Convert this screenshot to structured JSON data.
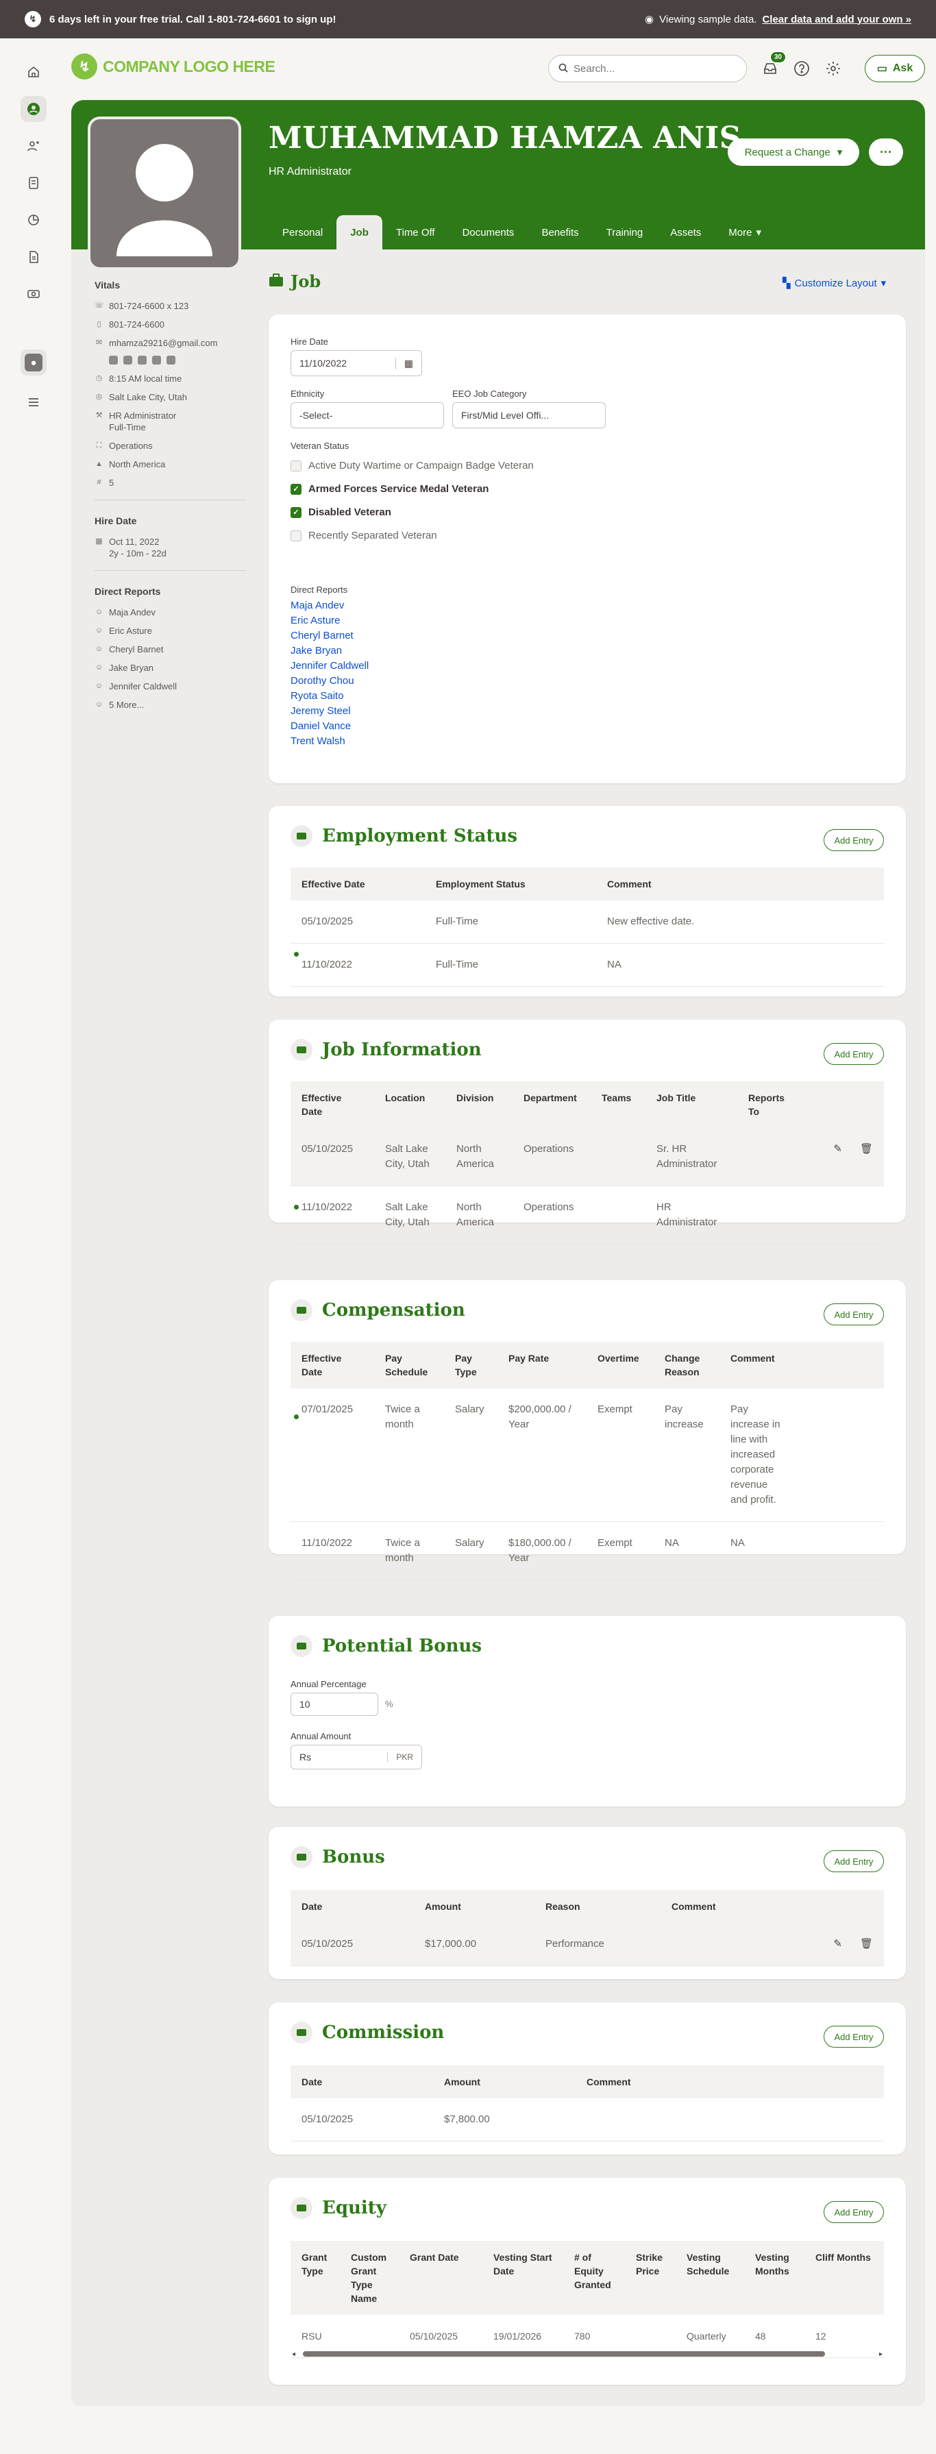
{
  "banner": {
    "days_text": "6 days left in your free trial.",
    "call_text": "Call 1-801-724-6601 to sign up!",
    "viewing": "Viewing sample data.",
    "clear_link": "Clear data and add your own »"
  },
  "header": {
    "logo": "COMPANY LOGO HERE",
    "search_placeholder": "Search...",
    "inbox_count": "30",
    "ask_label": "Ask"
  },
  "profile": {
    "name": "MUHAMMAD HAMZA ANIS",
    "title": "HR Administrator",
    "request_label": "Request a Change"
  },
  "tabs": [
    "Personal",
    "Job",
    "Time Off",
    "Documents",
    "Benefits",
    "Training",
    "Assets",
    "More"
  ],
  "vitals": {
    "heading": "Vitals",
    "phone_work": "801-724-6600 x 123",
    "phone_mobile": "801-724-6600",
    "email": "mhamza29216@gmail.com",
    "local_time": "8:15 AM local time",
    "location": "Salt Lake City, Utah",
    "job_title": "HR Administrator",
    "job_type": "Full-Time",
    "department": "Operations",
    "region": "North America",
    "employee_no": "5"
  },
  "hire": {
    "heading": "Hire Date",
    "date": "Oct 11, 2022",
    "tenure": "2y - 10m - 22d"
  },
  "direct_side": {
    "heading": "Direct Reports",
    "names": [
      "Maja Andev",
      "Eric Asture",
      "Cheryl Barnet",
      "Jake Bryan",
      "Jennifer Caldwell"
    ],
    "more": "5 More..."
  },
  "job": {
    "heading": "Job",
    "customize": "Customize Layout",
    "hire_label": "Hire Date",
    "hire_value": "11/10/2022",
    "ethnicity_label": "Ethnicity",
    "ethnicity_value": "-Select-",
    "eeo_label": "EEO Job Category",
    "eeo_value": "First/Mid Level Offi...",
    "veteran_label": "Veteran Status",
    "veteran": [
      {
        "label": "Active Duty Wartime or Campaign Badge Veteran",
        "checked": false
      },
      {
        "label": "Armed Forces Service Medal Veteran",
        "checked": true
      },
      {
        "label": "Disabled Veteran",
        "checked": true
      },
      {
        "label": "Recently Separated Veteran",
        "checked": false
      }
    ],
    "reports_label": "Direct Reports",
    "reports": [
      "Maja Andev",
      "Eric Asture",
      "Cheryl Barnet",
      "Jake Bryan",
      "Jennifer Caldwell",
      "Dorothy Chou",
      "Ryota Saito",
      "Jeremy Steel",
      "Daniel Vance",
      "Trent Walsh"
    ]
  },
  "add_entry": "Add Entry",
  "employment": {
    "heading": "Employment Status",
    "cols": [
      "Effective Date",
      "Employment Status",
      "Comment"
    ],
    "rows": [
      [
        "05/10/2025",
        "Full-Time",
        "New effective date."
      ],
      [
        "11/10/2022",
        "Full-Time",
        "NA"
      ]
    ]
  },
  "jobinfo": {
    "heading": "Job Information",
    "cols": [
      "Effective Date",
      "Location",
      "Division",
      "Department",
      "Teams",
      "Job Title",
      "Reports To"
    ],
    "rows": [
      [
        "05/10/2025",
        "Salt Lake City, Utah",
        "North America",
        "Operations",
        "",
        "Sr. HR Administrator",
        ""
      ],
      [
        "11/10/2022",
        "Salt Lake City, Utah",
        "North America",
        "Operations",
        "",
        "HR Administrator",
        ""
      ]
    ]
  },
  "comp": {
    "heading": "Compensation",
    "cols": [
      "Effective Date",
      "Pay Schedule",
      "Pay Type",
      "Pay Rate",
      "Overtime",
      "Change Reason",
      "Comment"
    ],
    "rows": [
      [
        "07/01/2025",
        "Twice a month",
        "Salary",
        "$200,000.00 / Year",
        "Exempt",
        "Pay increase",
        "Pay increase in line with increased corporate revenue and profit."
      ],
      [
        "11/10/2022",
        "Twice a month",
        "Salary",
        "$180,000.00 / Year",
        "Exempt",
        "NA",
        "NA"
      ]
    ]
  },
  "potential": {
    "heading": "Potential Bonus",
    "pct_label": "Annual Percentage",
    "pct_value": "10",
    "pct_unit": "%",
    "amt_label": "Annual Amount",
    "amt_prefix": "Rs",
    "amt_unit": "PKR"
  },
  "bonus": {
    "heading": "Bonus",
    "cols": [
      "Date",
      "Amount",
      "Reason",
      "Comment"
    ],
    "rows": [
      [
        "05/10/2025",
        "$17,000.00",
        "Performance",
        ""
      ]
    ]
  },
  "commission": {
    "heading": "Commission",
    "cols": [
      "Date",
      "Amount",
      "Comment"
    ],
    "rows": [
      [
        "05/10/2025",
        "$7,800.00",
        ""
      ]
    ]
  },
  "equity": {
    "heading": "Equity",
    "cols": [
      "Grant Type",
      "Custom Grant Type Name",
      "Grant Date",
      "Vesting Start Date",
      "# of Equity Granted",
      "Strike Price",
      "Vesting Schedule",
      "Vesting Months",
      "Cliff Months"
    ],
    "rows": [
      [
        "RSU",
        "",
        "05/10/2025",
        "19/01/2026",
        "780",
        "",
        "Quarterly",
        "48",
        "12"
      ]
    ]
  },
  "colors": {
    "brand": "#2e7918",
    "logo": "#83c341",
    "link": "#0b4fd1"
  }
}
